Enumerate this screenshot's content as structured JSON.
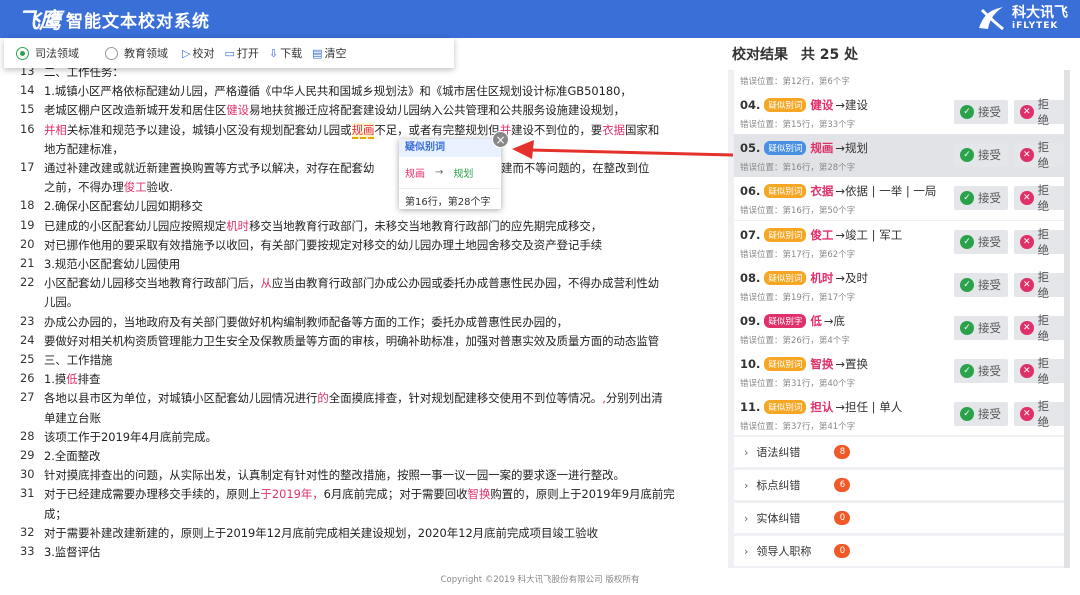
{
  "header": {
    "logo_text": "飞鹰",
    "title": "智能文本校对系统",
    "brand_cn": "科大讯飞",
    "brand_en": "iFLYTEK"
  },
  "toolbar": {
    "domains": [
      {
        "label": "司法领域",
        "selected": true
      },
      {
        "label": "教育领域",
        "selected": false
      }
    ],
    "proofread_label": "校对",
    "open_label": "打开",
    "download_label": "下载",
    "clear_label": "清空"
  },
  "document": {
    "lines": [
      {
        "num": "13",
        "text": "二、工作任务："
      },
      {
        "num": "14",
        "text": "1.城镇小区严格依标配建幼儿园，严格遵循《中华人民共和国城乡规划法》和《城市居住区规划设计标准GB50180，"
      },
      {
        "num": "15",
        "pre": "老城区棚户区改造新城开发和居住区",
        "mark": "健设",
        "post": "易地扶贫搬迁应将配套建设幼儿园纳入公共管理和公共服务设施建设规划，"
      },
      {
        "num": "16",
        "text": ""
      },
      {
        "num": "",
        "text": "地方配建标准，"
      },
      {
        "num": "17",
        "text": "通过补建改建或就近新建置换购置等方式予以解决，对存在配套幼",
        "post": "建和建而不等问题的，在整改到位"
      },
      {
        "num": "",
        "pre": "之前，不得办理",
        "mark": "俊工",
        "post": "验收."
      },
      {
        "num": "18",
        "text": "2.确保小区配套幼儿园如期移交"
      },
      {
        "num": "19",
        "pre": "已建成的小区配套幼儿园应按照规定",
        "mark": "机时",
        "post": "移交当地教育行政部门，未移交当地教育行政部门的应先期完成移交，"
      },
      {
        "num": "20",
        "text": "对已挪作他用的要采取有效措施予以收回，有关部门要按规定对移交的幼儿园办理土地园舍移交及资产登记手续"
      },
      {
        "num": "21",
        "text": "3.规范小区配套幼儿园使用"
      },
      {
        "num": "22",
        "pre": "小区配套幼儿园移交当地教育行政部门后，",
        "mark": "从",
        "post": "应当由教育行政部门办成公办园或委托办成普惠性民办园，不得办成营利性幼"
      },
      {
        "num": "",
        "text": "儿园。"
      },
      {
        "num": "23",
        "text": "办成公办园的，当地政府及有关部门要做好机构编制教师配备等方面的工作；委托办成普惠性民办园的，"
      },
      {
        "num": "24",
        "text": "要做好对相关机构资质管理能力卫生安全及保教质量等方面的审核，明确补助标准，加强对普惠实效及质量方面的动态监管"
      },
      {
        "num": "25",
        "text": "三、工作措施"
      },
      {
        "num": "26",
        "pre": "1.摸",
        "mark": "低",
        "post": "排查"
      },
      {
        "num": "27",
        "pre": "各地以县市区为单位，对城镇小区配套幼儿园情况进行",
        "mark": "的",
        "post": "全面摸底排查，针对规划配建移交使用不到位等情况。",
        "mark2": ",",
        "post2": "分别列出清"
      },
      {
        "num": "",
        "text": "单建立台账"
      },
      {
        "num": "28",
        "text": "该项工作于2019年4月底前完成。"
      },
      {
        "num": "29",
        "text": "2.全面整改"
      },
      {
        "num": "30",
        "text": "针对摸底排查出的问题，从实际出发，认真制定有针对性的整改措施，按照一事一议一园一案的要求逐一进行整改。"
      },
      {
        "num": "31",
        "pre": "对于已经建成需要办理移交手续的，原则上",
        "mark": "于2019年，",
        "post": "6月底前完成；对于需要回收",
        "mark2": "智换",
        "post2": "购置的，原则上于2019年9月底前完"
      },
      {
        "num": "",
        "text": "成；"
      },
      {
        "num": "32",
        "text": "对于需要补建改建新建的，原则上于2019年12月底前完成相关建设规划，2020年12月底前完成项目竣工验收"
      },
      {
        "num": "33",
        "text": "3.监督评估"
      }
    ],
    "line16": {
      "pre": "",
      "mark_a": "并相",
      "mid1": "关标准和规范予以建设，城镇小区没有规划配套幼儿园或",
      "mark_b": "规画",
      "mid2": "不足，或者有完整规划但",
      "mark_c": "并",
      "mid3": "建设不到位的，要",
      "mark_d": "衣据",
      "post": "国家和"
    }
  },
  "tooltip": {
    "title": "疑似别词",
    "from": "规画",
    "arrow": "→",
    "to": "规划",
    "position": "第16行，第28个字",
    "close": "×"
  },
  "results": {
    "title": "校对结果",
    "count_text": "共 25 处",
    "partial_pos": "错误位置：第12行，第6个字",
    "items": [
      {
        "num": "04.",
        "tag": "疑似别词",
        "word": "健设",
        "suggestion": "→建设",
        "pos": "错误位置：第15行，第33个字",
        "tag_color": "orange"
      },
      {
        "num": "05.",
        "tag": "疑似别词",
        "word": "规画",
        "suggestion": "→规划",
        "pos": "错误位置：第16行，第28个字",
        "tag_color": "blue",
        "active": true
      },
      {
        "num": "06.",
        "tag": "疑似别词",
        "word": "衣据",
        "suggestion": "→依据 | 一举 | 一局",
        "pos": "错误位置：第16行，第50个字",
        "tag_color": "orange"
      },
      {
        "num": "07.",
        "tag": "疑似别词",
        "word": "俊工",
        "suggestion": "→竣工 | 军工",
        "pos": "错误位置：第17行，第62个字",
        "tag_color": "orange"
      },
      {
        "num": "08.",
        "tag": "疑似别词",
        "word": "机时",
        "suggestion": "→及时",
        "pos": "错误位置：第19行，第17个字",
        "tag_color": "orange"
      },
      {
        "num": "09.",
        "tag": "疑似别字",
        "word": "低",
        "suggestion": "→底",
        "pos": "错误位置：第26行，第4个字",
        "tag_color": "red"
      },
      {
        "num": "10.",
        "tag": "疑似别词",
        "word": "智换",
        "suggestion": "→置换",
        "pos": "错误位置：第31行，第40个字",
        "tag_color": "orange"
      },
      {
        "num": "11.",
        "tag": "疑似别词",
        "word": "担认",
        "suggestion": "→担任 | 单人",
        "pos": "错误位置：第37行，第41个字",
        "tag_color": "orange"
      }
    ],
    "accept_label": "接受",
    "reject_label": "拒绝",
    "categories": [
      {
        "label": "语法纠错",
        "count": "8"
      },
      {
        "label": "标点纠错",
        "count": "6"
      },
      {
        "label": "实体纠错",
        "count": "0"
      },
      {
        "label": "领导人职称",
        "count": "0"
      }
    ]
  },
  "footer": {
    "copyright": "Copyright ©2019 科大讯飞股份有限公司 版权所有"
  },
  "colors": {
    "header_blue": "#3a6fd8",
    "error_red": "#e0306a",
    "accept_green": "#2aa24b",
    "tag_orange": "#f5a623",
    "tag_blue": "#4a90e2",
    "count_badge": "#f05a28"
  }
}
